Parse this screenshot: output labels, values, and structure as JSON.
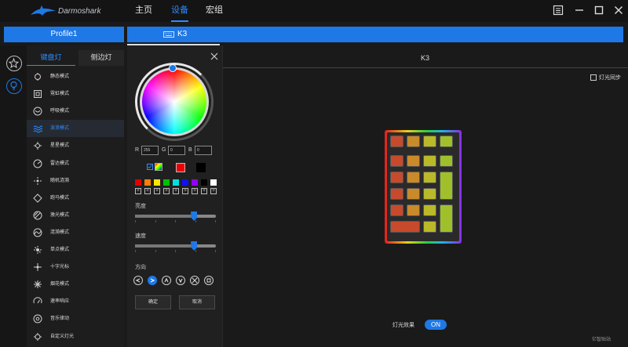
{
  "app": {
    "brand": "Darmoshark",
    "nav": [
      "主页",
      "设备",
      "宏组"
    ],
    "nav_active": 1
  },
  "tabs": {
    "profile": "Profile1",
    "device": "K3"
  },
  "effects": {
    "subtabs": [
      "键盘灯",
      "侧边灯"
    ],
    "items": [
      {
        "label": "静态模式",
        "icon": "static-icon"
      },
      {
        "label": "霓虹模式",
        "icon": "neon-icon"
      },
      {
        "label": "呼吸模式",
        "icon": "breathing-icon"
      },
      {
        "label": "波浪模式",
        "icon": "wave-icon"
      },
      {
        "label": "星星模式",
        "icon": "stars-icon"
      },
      {
        "label": "雷达模式",
        "icon": "radar-icon"
      },
      {
        "label": "随机涟漪",
        "icon": "ripple-icon"
      },
      {
        "label": "跑马模式",
        "icon": "marquee-icon"
      },
      {
        "label": "激光模式",
        "icon": "laser-icon"
      },
      {
        "label": "涟漪模式",
        "icon": "ripple2-icon"
      },
      {
        "label": "单点模式",
        "icon": "single-point-icon"
      },
      {
        "label": "十字光标",
        "icon": "crosshair-icon"
      },
      {
        "label": "烟花模式",
        "icon": "fireworks-icon"
      },
      {
        "label": "速率响应",
        "icon": "speed-icon"
      },
      {
        "label": "音乐律动",
        "icon": "music-icon"
      },
      {
        "label": "自定义灯光",
        "icon": "custom-icon"
      }
    ],
    "selected_index": 3
  },
  "panel": {
    "r_label": "R",
    "g_label": "G",
    "b_label": "B",
    "r": "255",
    "g": "0",
    "b": "0",
    "swatches": [
      "#e00000",
      "#ff8000",
      "#ffe600",
      "#00c000",
      "#00e0e0",
      "#1010ff",
      "#9000ff",
      "#000000",
      "#ffffff"
    ],
    "brightness_label": "亮度",
    "brightness_pct": 73,
    "speed_label": "速度",
    "speed_pct": 73,
    "direction_label": "方向",
    "direction_selected": 1,
    "confirm": "确定",
    "cancel": "取消"
  },
  "main": {
    "device_title": "K3",
    "sync_label": "灯光同步",
    "effect_label": "灯光效果",
    "toggle": "ON",
    "watermark": "亿智贴站"
  },
  "colors": {
    "accent": "#1e78e6",
    "background": "#1a1a1a"
  }
}
